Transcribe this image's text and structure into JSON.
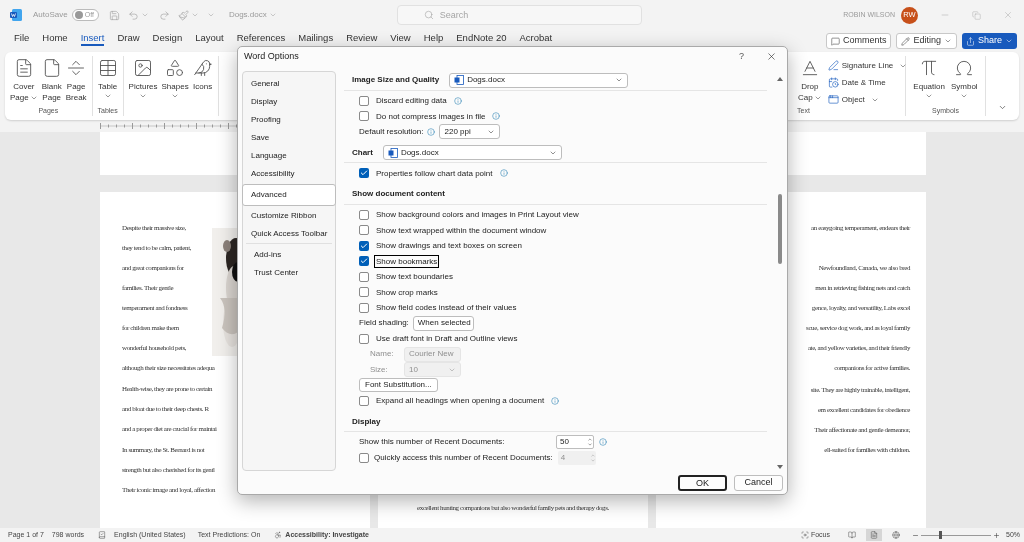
{
  "title_bar": {
    "autosave_label": "AutoSave",
    "autosave": {
      "on": false,
      "label": "Off"
    },
    "filename": "Dogs.docx",
    "search_placeholder": "Search",
    "user_name": "ROBIN WILSON",
    "user_initials": "RW"
  },
  "ribbon_tabs": [
    {
      "label": "File",
      "selected": false
    },
    {
      "label": "Home",
      "selected": false
    },
    {
      "label": "Insert",
      "selected": true
    },
    {
      "label": "Draw",
      "selected": false
    },
    {
      "label": "Design",
      "selected": false
    },
    {
      "label": "Layout",
      "selected": false
    },
    {
      "label": "References",
      "selected": false
    },
    {
      "label": "Mailings",
      "selected": false
    },
    {
      "label": "Review",
      "selected": false
    },
    {
      "label": "View",
      "selected": false
    },
    {
      "label": "Help",
      "selected": false
    },
    {
      "label": "EndNote 20",
      "selected": false
    },
    {
      "label": "Acrobat",
      "selected": false
    }
  ],
  "actions": [
    {
      "kind": "comments",
      "label": "Comments"
    },
    {
      "kind": "editing",
      "label": "Editing"
    },
    {
      "kind": "share",
      "label": "Share"
    }
  ],
  "ribbon": {
    "left_groups": [
      {
        "label": "Pages",
        "commands": [
          {
            "lines": [
              "Cover",
              "Page"
            ],
            "dropdown": true
          },
          {
            "lines": [
              "Blank",
              "Page"
            ],
            "dropdown": false
          },
          {
            "lines": [
              "Page",
              "Break"
            ],
            "dropdown": false
          }
        ]
      },
      {
        "label": "Tables",
        "commands": [
          {
            "lines": [
              "Table"
            ],
            "dropdown": true
          }
        ]
      },
      {
        "commands": [
          {
            "lines": [
              "Pictures"
            ],
            "dropdown": true
          },
          {
            "lines": [
              "Shapes"
            ],
            "dropdown": true
          },
          {
            "lines": [
              "Icons"
            ],
            "dropdown": false
          }
        ]
      }
    ],
    "text_group": {
      "label": "Text",
      "big": {
        "lines": [
          "Drop",
          "Cap"
        ],
        "dropdown": true
      },
      "small": [
        {
          "label": "Signature Line",
          "dropdown": true
        },
        {
          "label": "Date & Time",
          "dropdown": false
        },
        {
          "label": "Object",
          "dropdown": true
        }
      ]
    },
    "symbols_group": {
      "label": "Symbols",
      "commands": [
        {
          "lines": [
            "Equation"
          ],
          "dropdown": true
        },
        {
          "lines": [
            "Symbol"
          ],
          "dropdown": true
        }
      ]
    }
  },
  "document": {
    "left_page": {
      "wrapped_lines": [
        "Despite their massive size,",
        "they tend to be calm, patient,",
        "and great companions for",
        "families. Their gentle",
        "temperament and fondness",
        "for children make them",
        "wonderful household pets,"
      ],
      "figure": {
        "kind": "picture"
      },
      "paragraphs": [
        [
          "although their size necessitates adequa"
        ],
        [
          "Health-wise, they are prone to certain",
          "and bloat due to their deep chests. R",
          "and a proper diet are crucial for maintai"
        ],
        [
          "In summary, the St. Bernard is not",
          "strength but also cherished for its gentl",
          "Their iconic image and loyal, affection"
        ]
      ]
    },
    "middle_page": {
      "lines": [
        "excellent hunting companions but also wonderful family pets and therapy dogs."
      ]
    },
    "right_page": {
      "paragraphs": [
        [
          "an easygoing temperament, endears their"
        ],
        [
          "Newfoundland, Canada, we also bred",
          "men in retrieving fishing nets and catch",
          "gence, loyalty, and versatility, Labs excel",
          "scue, service dog work, and as loyal family",
          "ate, and yellow varieties, and their friendly",
          "companions for active families."
        ],
        [
          "site. They are highly trainable, intelligent,",
          "em excellent candidates for obedience",
          "Their affectionate and gentle demeanor,",
          "ell-suited for families with children."
        ]
      ]
    }
  },
  "dialog": {
    "title": "Word Options",
    "help": "?",
    "nav": [
      [
        {
          "label": "General",
          "selected": false
        },
        {
          "label": "Display",
          "selected": false
        },
        {
          "label": "Proofing",
          "selected": false
        },
        {
          "label": "Save",
          "selected": false
        },
        {
          "label": "Language",
          "selected": false
        },
        {
          "label": "Accessibility",
          "selected": false
        },
        {
          "label": "Advanced",
          "selected": true
        },
        {
          "label": "Customize Ribbon",
          "selected": false
        },
        {
          "label": "Quick Access Toolbar",
          "selected": false
        }
      ],
      [
        {
          "label": "Add-ins",
          "selected": false
        },
        {
          "label": "Trust Center",
          "selected": false
        }
      ]
    ],
    "rows": [
      {
        "kind": "heading",
        "label": "Image Size and Quality",
        "dropdown": "Dogs.docx"
      },
      {
        "kind": "checkbox",
        "label": "Discard editing data",
        "checked": false,
        "info": true
      },
      {
        "kind": "checkbox",
        "label": "Do not compress images in file",
        "checked": false,
        "info": true
      },
      {
        "kind": "select",
        "label": "Default resolution:",
        "value": "220 ppi",
        "info": true,
        "disabled": false
      },
      {
        "kind": "heading",
        "label": "Chart",
        "dropdown": "Dogs.docx"
      },
      {
        "kind": "checkbox",
        "label": "Properties follow chart data point",
        "checked": true,
        "info": true
      },
      {
        "kind": "heading",
        "label": "Show document content"
      },
      {
        "kind": "checkbox",
        "label": "Show background colors and images in Print Layout view",
        "checked": false
      },
      {
        "kind": "checkbox",
        "label": "Show text wrapped within the document window",
        "checked": false
      },
      {
        "kind": "checkbox",
        "label": "Show drawings and text boxes on screen",
        "checked": true
      },
      {
        "kind": "checkbox",
        "label": "Show bookmarks",
        "checked": true,
        "focused": true
      },
      {
        "kind": "checkbox",
        "label": "Show text boundaries",
        "checked": false
      },
      {
        "kind": "checkbox",
        "label": "Show crop marks",
        "checked": false
      },
      {
        "kind": "checkbox",
        "label": "Show field codes instead of their values",
        "checked": false
      },
      {
        "kind": "select",
        "label": "Field shading:",
        "value": "When selected",
        "disabled": false
      },
      {
        "kind": "checkbox",
        "label": "Use draft font in Draft and Outline views",
        "checked": false
      },
      {
        "kind": "select",
        "label": "Name:",
        "value": "Courier New",
        "disabled": true
      },
      {
        "kind": "select",
        "label": "Size:",
        "value": "10",
        "disabled": true
      },
      {
        "kind": "button",
        "label": "Font Substitution..."
      },
      {
        "kind": "checkbox",
        "label": "Expand all headings when opening a document",
        "checked": false,
        "info": true
      },
      {
        "kind": "heading",
        "label": "Display"
      },
      {
        "kind": "spinner",
        "label": "Show this number of Recent Documents:",
        "value": "50",
        "info": true,
        "disabled": false
      },
      {
        "kind": "checkbox_spinner",
        "label": "Quickly access this number of Recent Documents:",
        "checked": false,
        "value": "4",
        "disabled": true
      }
    ],
    "buttons": [
      {
        "label": "OK",
        "default": true
      },
      {
        "label": "Cancel",
        "default": false
      }
    ]
  },
  "status_bar": {
    "page": "Page 1 of 7",
    "words": "798 words",
    "language": "English (United States)",
    "predictions": "Text Predictions: On",
    "accessibility": "Accessibility: Investigate",
    "focus": "Focus",
    "views": [
      {
        "selected": false
      },
      {
        "selected": true
      },
      {
        "selected": false
      }
    ],
    "zoom": {
      "level": 0.27,
      "label": "50%"
    }
  }
}
